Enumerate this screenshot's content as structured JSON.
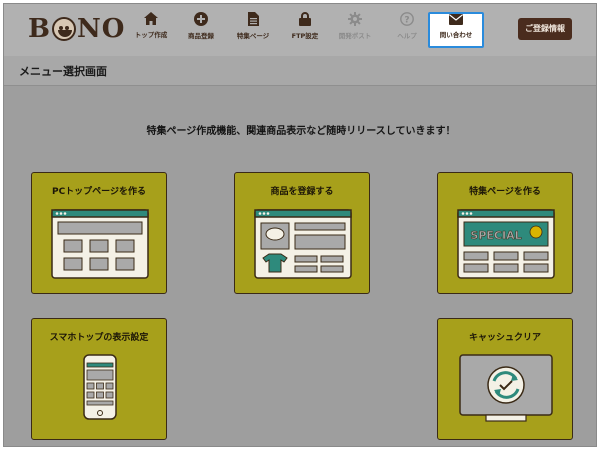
{
  "header": {
    "logo": "BONO",
    "nav": [
      {
        "label": "トップ作成",
        "icon": "home-icon"
      },
      {
        "label": "商品登録",
        "icon": "plus-circle-icon"
      },
      {
        "label": "特集ページ",
        "icon": "document-icon"
      },
      {
        "label": "FTP設定",
        "icon": "lock-icon"
      },
      {
        "label": "開発ボスト",
        "icon": "gear-icon"
      },
      {
        "label": "ヘルプ",
        "icon": "help-icon"
      },
      {
        "label": "問い合わせ",
        "icon": "envelope-icon"
      }
    ],
    "register_label": "ご登録情報"
  },
  "page": {
    "title": "メニュー選択画面",
    "notice": "特集ページ作成機能、関連商品表示など随時リリースしていきます！"
  },
  "cards": [
    {
      "title": "PCトップページを作る",
      "icon": "pc-layout-icon"
    },
    {
      "title": "商品を登録する",
      "icon": "product-register-icon"
    },
    {
      "title": "特集ページを作る",
      "icon": "special-page-icon",
      "banner_text": "SPECIAL"
    },
    {
      "title": "スマホトップの表示設定",
      "icon": "smartphone-icon"
    },
    {
      "title": "キャッシュクリア",
      "icon": "monitor-refresh-icon"
    }
  ],
  "colors": {
    "brand": "#4a2c1e",
    "card": "#a7a01b",
    "teal": "#2e8a7c",
    "active_border": "#2a8bdc"
  }
}
